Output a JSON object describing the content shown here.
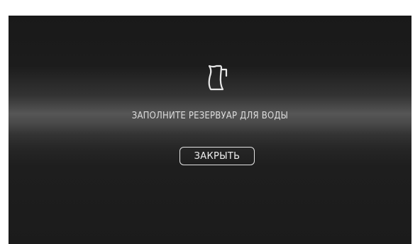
{
  "dialog": {
    "icon": "pitcher-icon",
    "message": "ЗАПОЛНИТЕ РЕЗЕРВУАР ДЛЯ ВОДЫ",
    "close_label": "ЗАКРЫТЬ"
  },
  "colors": {
    "background": "#1b1b1b",
    "highlight_band": "#565656",
    "text": "#dcdcdc",
    "button_border": "#e4e4e4"
  }
}
